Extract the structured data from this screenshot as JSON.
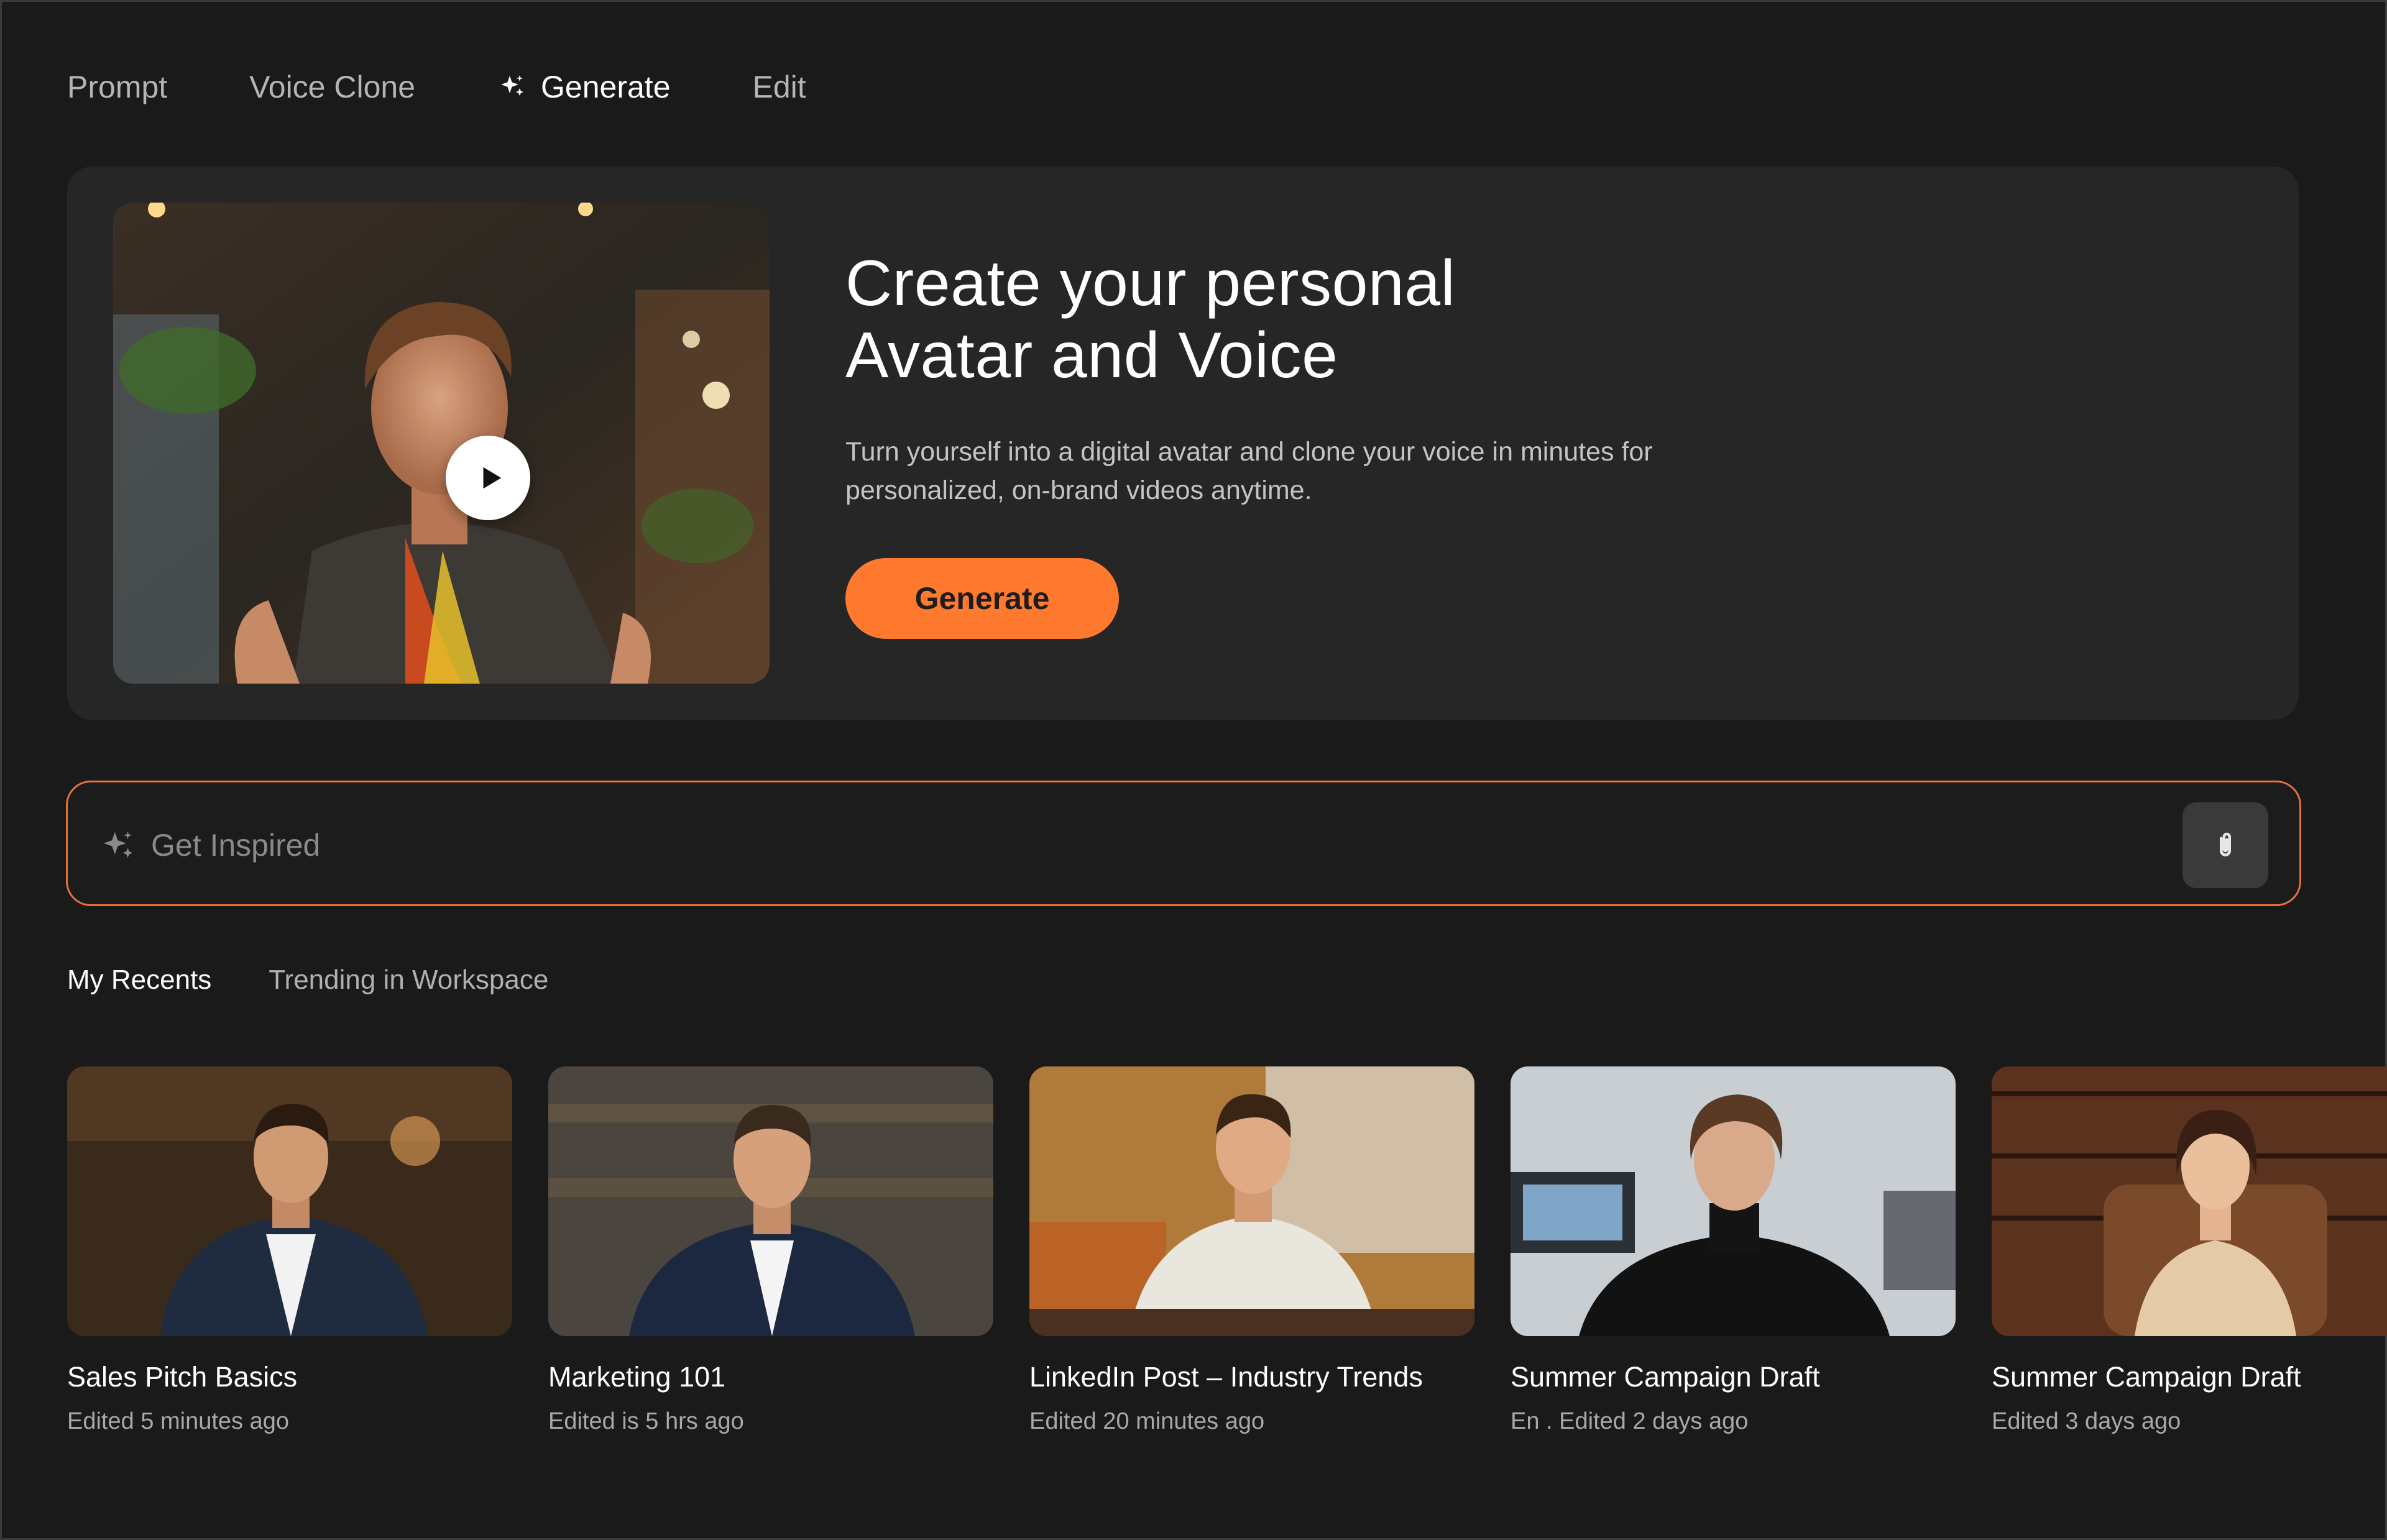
{
  "nav": {
    "items": [
      {
        "label": "Prompt"
      },
      {
        "label": "Voice Clone"
      },
      {
        "label": "Generate",
        "icon": "sparkle-icon"
      },
      {
        "label": "Edit"
      }
    ],
    "active": "Generate"
  },
  "hero": {
    "title_line1": "Create your personal",
    "title_line2": "Avatar and Voice",
    "description": "Turn yourself into a digital avatar and clone your voice in minutes for personalized, on-brand videos anytime.",
    "cta_label": "Generate",
    "media_icon": "play-icon"
  },
  "prompt": {
    "placeholder": "Get Inspired",
    "value": "",
    "attach_icon": "paperclip-icon"
  },
  "tabs": [
    {
      "label": "My Recents"
    },
    {
      "label": "Trending in Workspace"
    }
  ],
  "recents": [
    {
      "title": "Sales Pitch Basics",
      "meta": "Edited 5 minutes ago"
    },
    {
      "title": "Marketing 101",
      "meta": "Edited is 5 hrs ago"
    },
    {
      "title": "LinkedIn Post – Industry Trends",
      "meta": "Edited 20 minutes ago"
    },
    {
      "title": "Summer Campaign Draft",
      "meta": "En .   Edited 2 days ago"
    },
    {
      "title": "Summer Campaign Draft",
      "meta": "Edited 3 days ago"
    }
  ],
  "colors": {
    "background": "#1a1a1a",
    "card": "#262626",
    "accent": "#ff7a2f",
    "accent_border": "#e8713b"
  }
}
